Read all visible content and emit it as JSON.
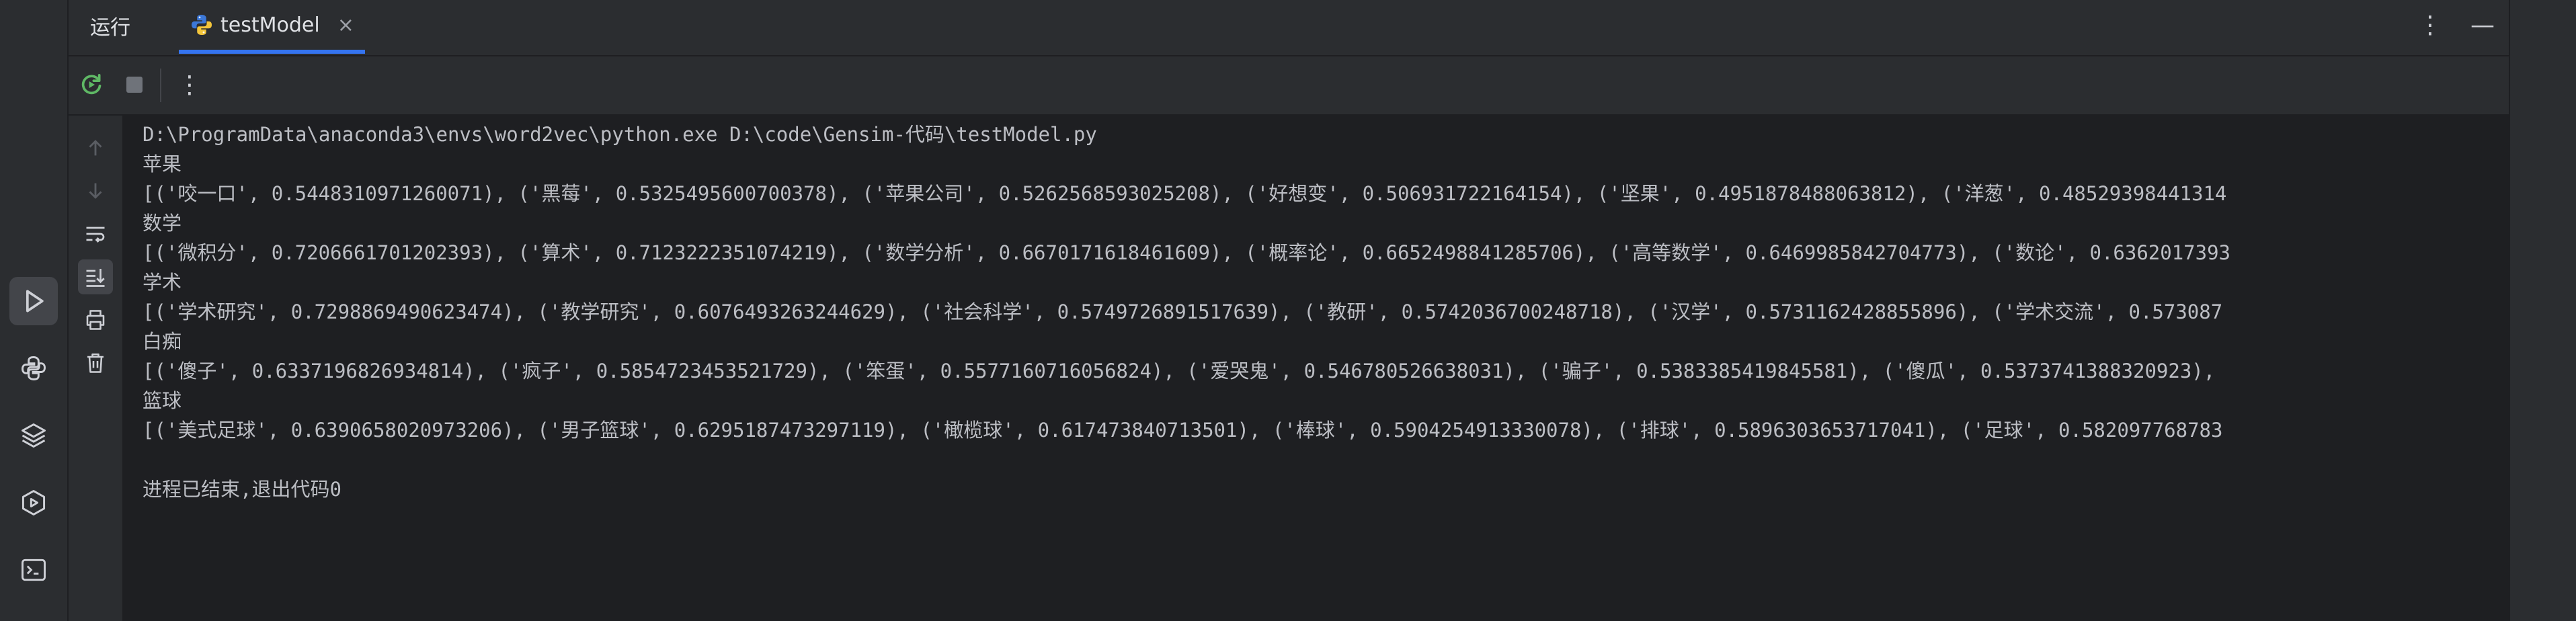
{
  "window": {
    "tool_title": "运行",
    "run_tab_label": "testModel",
    "run_tab_close": "×",
    "more_icon": "⋮",
    "minimize_icon": "—"
  },
  "toolbar": {
    "more_icon": "⋮"
  },
  "console": {
    "lines": [
      "D:\\ProgramData\\anaconda3\\envs\\word2vec\\python.exe D:\\code\\Gensim-代码\\testModel.py",
      "苹果",
      "[('咬一口', 0.5448310971260071), ('黑莓', 0.5325495600700378), ('苹果公司', 0.5262568593025208), ('好想变', 0.506931722164154), ('坚果', 0.4951878488063812), ('洋葱', 0.48529398441314",
      "数学",
      "[('微积分', 0.7206661701202393), ('算术', 0.7123222351074219), ('数学分析', 0.6670171618461609), ('概率论', 0.6652498841285706), ('高等数学', 0.6469985842704773), ('数论', 0.6362017393",
      "学术",
      "[('学术研究', 0.7298869490623474), ('教学研究', 0.6076493263244629), ('社会科学', 0.5749726891517639), ('教研', 0.5742036700248718), ('汉学', 0.5731162428855896), ('学术交流', 0.573087",
      "白痴",
      "[('傻子', 0.6337196826934814), ('疯子', 0.5854723453521729), ('笨蛋', 0.5577160716056824), ('爱哭鬼', 0.546780526638031), ('骗子', 0.5383385419845581), ('傻瓜', 0.5373741388320923), ",
      "篮球",
      "[('美式足球', 0.6390658020973206), ('男子篮球', 0.6295187473297119), ('橄榄球', 0.617473840713501), ('棒球', 0.5904254913330078), ('排球', 0.5896303653717041), ('足球', 0.582097768783",
      "",
      "进程已结束,退出代码0"
    ]
  },
  "colors": {
    "background": "#1e1f22",
    "panel": "#2b2d30",
    "text": "#bcbec4",
    "accent": "#3574f0",
    "run_green": "#5fb865"
  },
  "icons": {
    "activity_bar": [
      "run-icon",
      "python-console-icon",
      "layers-icon",
      "services-icon",
      "terminal-icon"
    ],
    "toolbar": [
      "rerun-icon",
      "stop-icon",
      "more-icon"
    ],
    "gutter": [
      "scroll-up-icon",
      "scroll-down-icon",
      "soft-wrap-icon",
      "scroll-to-end-icon",
      "print-icon",
      "trash-icon"
    ]
  }
}
